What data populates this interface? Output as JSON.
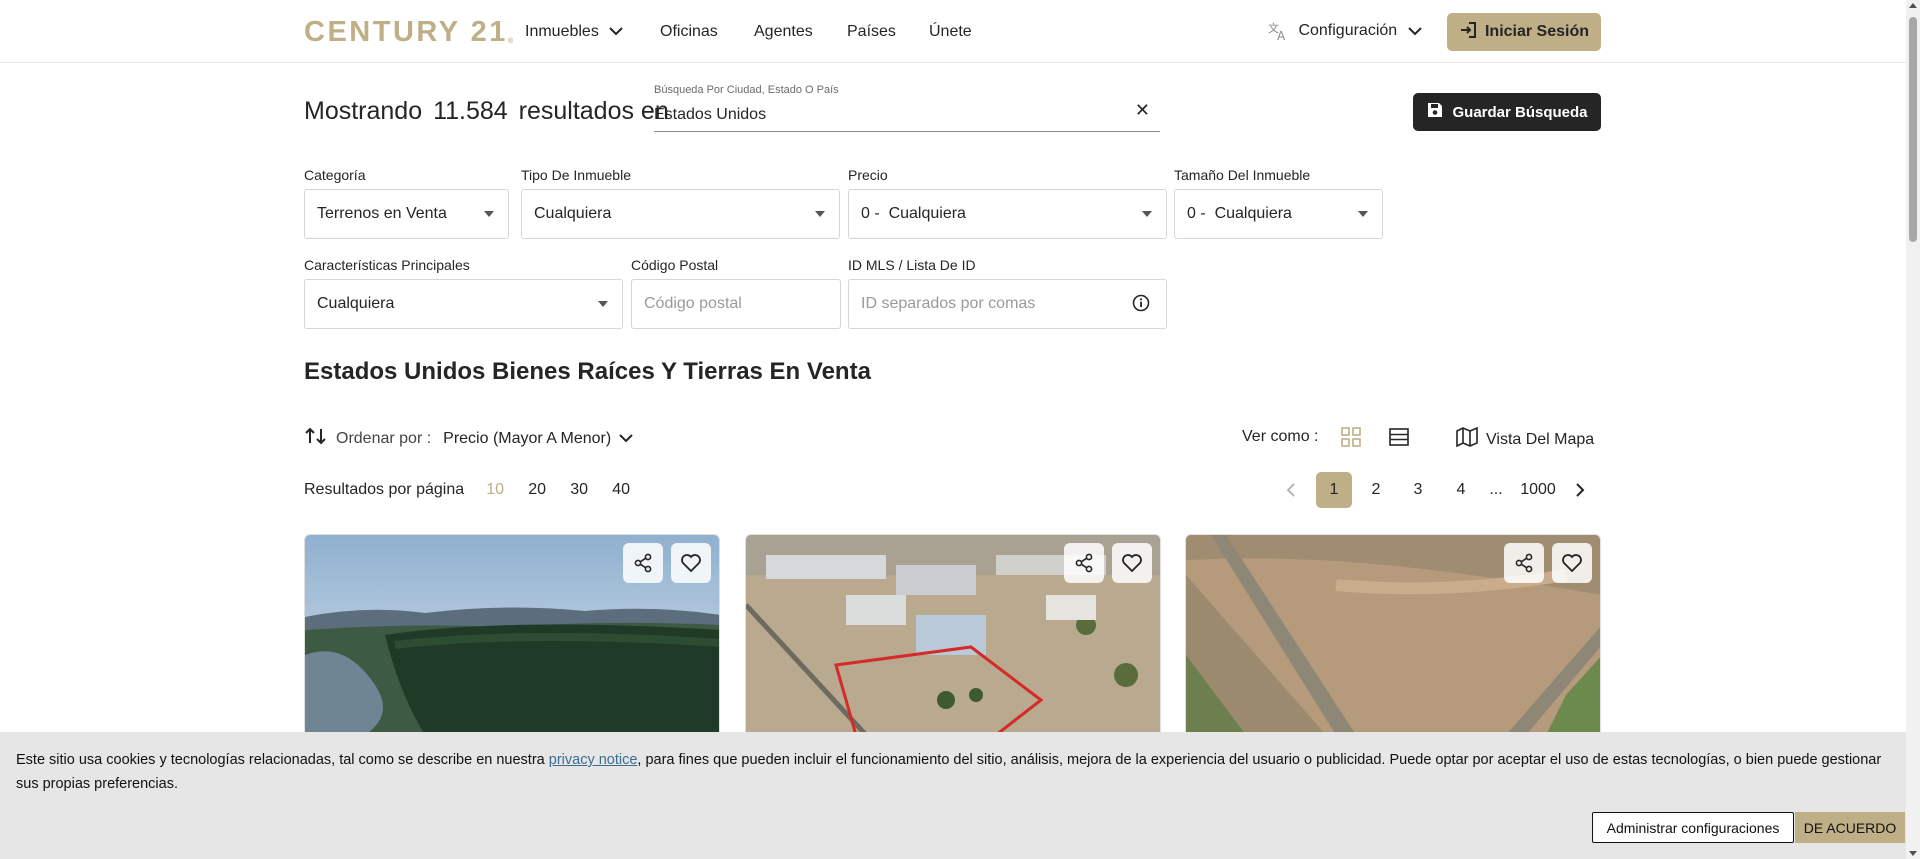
{
  "brand": {
    "logo_text": "CENTURY 21",
    "registered_mark": "®",
    "accent_color": "#beaf87",
    "dark_color": "#252526"
  },
  "nav": {
    "items": [
      {
        "label": "Inmuebles",
        "has_dropdown": true
      },
      {
        "label": "Oficinas"
      },
      {
        "label": "Agentes"
      },
      {
        "label": "Países"
      },
      {
        "label": "Únete"
      }
    ],
    "settings_label": "Configuración",
    "login_label": "Iniciar Sesión"
  },
  "search": {
    "results_prefix": "Mostrando",
    "results_count": "11.584",
    "results_suffix": "resultados en",
    "field_label": "Búsqueda Por Ciudad, Estado O País",
    "field_value": "Estados Unidos",
    "clear_symbol": "✕",
    "save_label": "Guardar Búsqueda"
  },
  "filters": {
    "category": {
      "label": "Categoría",
      "value": "Terrenos en Venta"
    },
    "property_type": {
      "label": "Tipo De Inmueble",
      "value": "Cualquiera"
    },
    "price": {
      "label": "Precio",
      "value": "0 -  Cualquiera"
    },
    "size": {
      "label": "Tamaño Del Inmueble",
      "value": "0 -  Cualquiera"
    },
    "features": {
      "label": "Características Principales",
      "value": "Cualquiera"
    },
    "postal_code": {
      "label": "Código Postal",
      "placeholder": "Código postal"
    },
    "mls_id": {
      "label": "ID MLS / Lista De ID",
      "placeholder": "ID separados por comas"
    }
  },
  "listing": {
    "headline": "Estados Unidos Bienes Raíces Y Tierras En Venta",
    "sort_label": "Ordenar por :",
    "sort_value": "Precio (Mayor A Menor)",
    "view_as_label": "Ver como :",
    "map_view_label": "Vista Del Mapa",
    "per_page_label": "Resultados por página",
    "per_page_options": [
      "10",
      "20",
      "30",
      "40"
    ],
    "per_page_selected": "10"
  },
  "pagination": {
    "pages": [
      "1",
      "2",
      "3",
      "4"
    ],
    "ellipsis": "...",
    "last_page": "1000",
    "current": "1"
  },
  "cards": [
    {
      "scene": "river-forest",
      "favorite": false
    },
    {
      "scene": "aerial-lot",
      "favorite": false
    },
    {
      "scene": "farm-field",
      "favorite": false
    }
  ],
  "cookie": {
    "text_before": "Este sitio usa cookies y tecnologías relacionadas, tal como se describe en nuestra ",
    "link_text": "privacy notice",
    "text_after": ", para fines que pueden incluir el funcionamiento del sitio, análisis, mejora de la experiencia del usuario o publicidad. Puede optar por aceptar el uso de estas tecnologías, o bien puede gestionar sus propias preferencias.",
    "manage_label": "Administrar configuraciones",
    "agree_label": "DE ACUERDO"
  }
}
